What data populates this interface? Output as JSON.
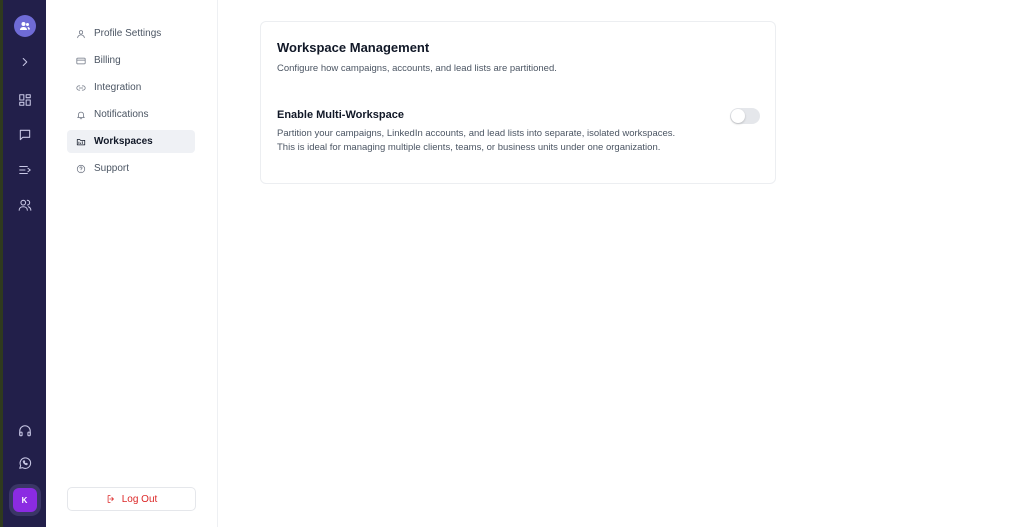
{
  "rail": {
    "icons": [
      "users-logo-icon",
      "chevron-right-icon",
      "dashboard-icon",
      "message-icon",
      "list-icon",
      "contacts-icon",
      "headphones-icon",
      "whatsapp-icon"
    ],
    "avatar_initial": "K"
  },
  "sidebar": {
    "items": [
      {
        "label": "Profile Settings",
        "icon": "user-icon"
      },
      {
        "label": "Billing",
        "icon": "credit-card-icon"
      },
      {
        "label": "Integration",
        "icon": "link-icon"
      },
      {
        "label": "Notifications",
        "icon": "bell-icon"
      },
      {
        "label": "Workspaces",
        "icon": "folder-icon",
        "active": true
      },
      {
        "label": "Support",
        "icon": "help-circle-icon"
      }
    ],
    "logout_label": "Log Out"
  },
  "main": {
    "title": "Workspace Management",
    "subtitle": "Configure how campaigns, accounts, and lead lists are partitioned.",
    "option": {
      "title": "Enable Multi-Workspace",
      "description": "Partition your campaigns, LinkedIn accounts, and lead lists into separate, isolated workspaces. This is ideal for managing multiple clients, teams, or business units under one organization.",
      "enabled": false
    }
  },
  "colors": {
    "rail_bg": "#221f4a",
    "accent": "#6f6bd6",
    "avatar": "#8b2be2",
    "danger": "#dc2626"
  }
}
